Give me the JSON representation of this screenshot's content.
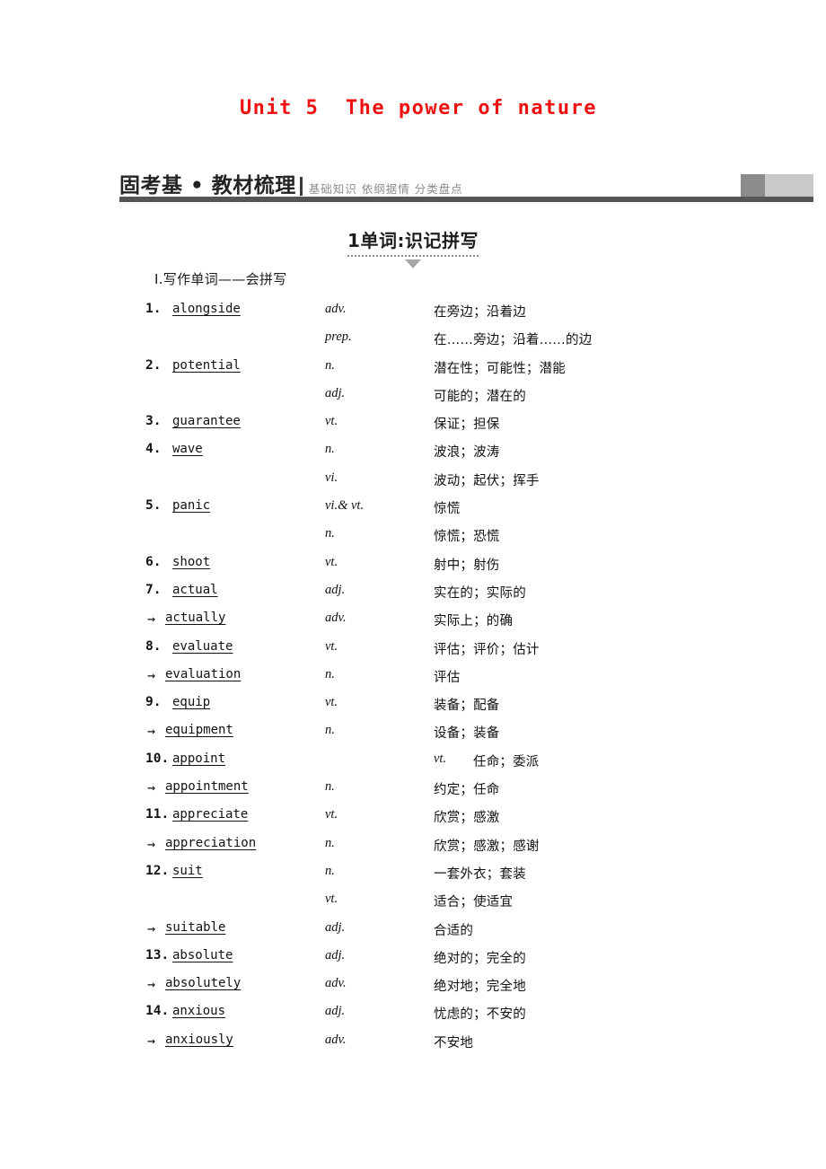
{
  "unit_title": "Unit 5  The power of nature",
  "section_header": {
    "title": "固考基 • 教材梳理",
    "subtitle": "基础知识 依纲据情 分类盘点"
  },
  "subsection": {
    "title": "1单词:识记拼写"
  },
  "list_heading": "Ⅰ.写作单词——会拼写",
  "colors": {
    "title_red": "#ee1111",
    "rule_gray": "#555555",
    "block_dark": "#8b8b8b",
    "block_light": "#c9c9c9",
    "subtitle_gray": "#8c8c8c"
  },
  "vocab_rows": [
    {
      "num": "1.",
      "word": "alongside",
      "pos": "adv.",
      "meaning": "在旁边；沿着边"
    },
    {
      "num": "",
      "word": "",
      "pos": "prep.",
      "meaning": "在……旁边；沿着……的边"
    },
    {
      "num": "2.",
      "word": "potential",
      "pos": "n.",
      "meaning": "潜在性；可能性；潜能"
    },
    {
      "num": "",
      "word": "",
      "pos": "adj.",
      "meaning": "可能的；潜在的"
    },
    {
      "num": "3.",
      "word": "guarantee",
      "pos": "vt.",
      "meaning": "保证；担保"
    },
    {
      "num": "4.",
      "word": "wave",
      "pos": "n.",
      "meaning": "波浪；波涛"
    },
    {
      "num": "",
      "word": "",
      "pos": "vi.",
      "meaning": "波动；起伏；挥手"
    },
    {
      "num": "5.",
      "word": "panic",
      "pos": "vi.& vt.",
      "meaning": "惊慌"
    },
    {
      "num": "",
      "word": "",
      "pos": "n.",
      "meaning": "惊慌；恐慌"
    },
    {
      "num": "6.",
      "word": "shoot",
      "pos": "vt.",
      "meaning": "射中；射伤"
    },
    {
      "num": "7.",
      "word": "actual",
      "pos": "adj.",
      "meaning": "实在的；实际的"
    },
    {
      "num": "→",
      "word": "actually",
      "pos": "adv.",
      "meaning": "实际上；的确"
    },
    {
      "num": "8.",
      "word": "evaluate",
      "pos": "vt.",
      "meaning": "评估；评价；估计"
    },
    {
      "num": "→",
      "word": "evaluation",
      "pos": "n.",
      "meaning": "评估"
    },
    {
      "num": "9.",
      "word": "equip",
      "pos": "vt.",
      "meaning": "装备；配备"
    },
    {
      "num": "→",
      "word": "equipment",
      "pos": "n.",
      "meaning": "设备；装备"
    },
    {
      "num": "10.",
      "word": "appoint",
      "pos": "vt.",
      "meaning": "任命；委派"
    },
    {
      "num": "→",
      "word": "appointment",
      "pos": "n.",
      "meaning": "约定；任命"
    },
    {
      "num": "11.",
      "word": "appreciate",
      "pos": "vt.",
      "meaning": "欣赏；感激"
    },
    {
      "num": "→",
      "word": "appreciation",
      "pos": "n.",
      "meaning": "欣赏；感激；感谢"
    },
    {
      "num": "12.",
      "word": "suit",
      "pos": "n.",
      "meaning": "一套外衣；套装"
    },
    {
      "num": "",
      "word": "",
      "pos": "vt.",
      "meaning": "适合；使适宜"
    },
    {
      "num": "→",
      "word": "suitable",
      "pos": "adj.",
      "meaning": "合适的"
    },
    {
      "num": "13.",
      "word": "absolute",
      "pos": "adj.",
      "meaning": "绝对的；完全的"
    },
    {
      "num": "→",
      "word": "absolutely",
      "pos": "adv.",
      "meaning": "绝对地；完全地"
    },
    {
      "num": "14.",
      "word": "anxious",
      "pos": "adj.",
      "meaning": "忧虑的；不安的"
    },
    {
      "num": "→",
      "word": "anxiously",
      "pos": "adv.",
      "meaning": "不安地"
    }
  ]
}
